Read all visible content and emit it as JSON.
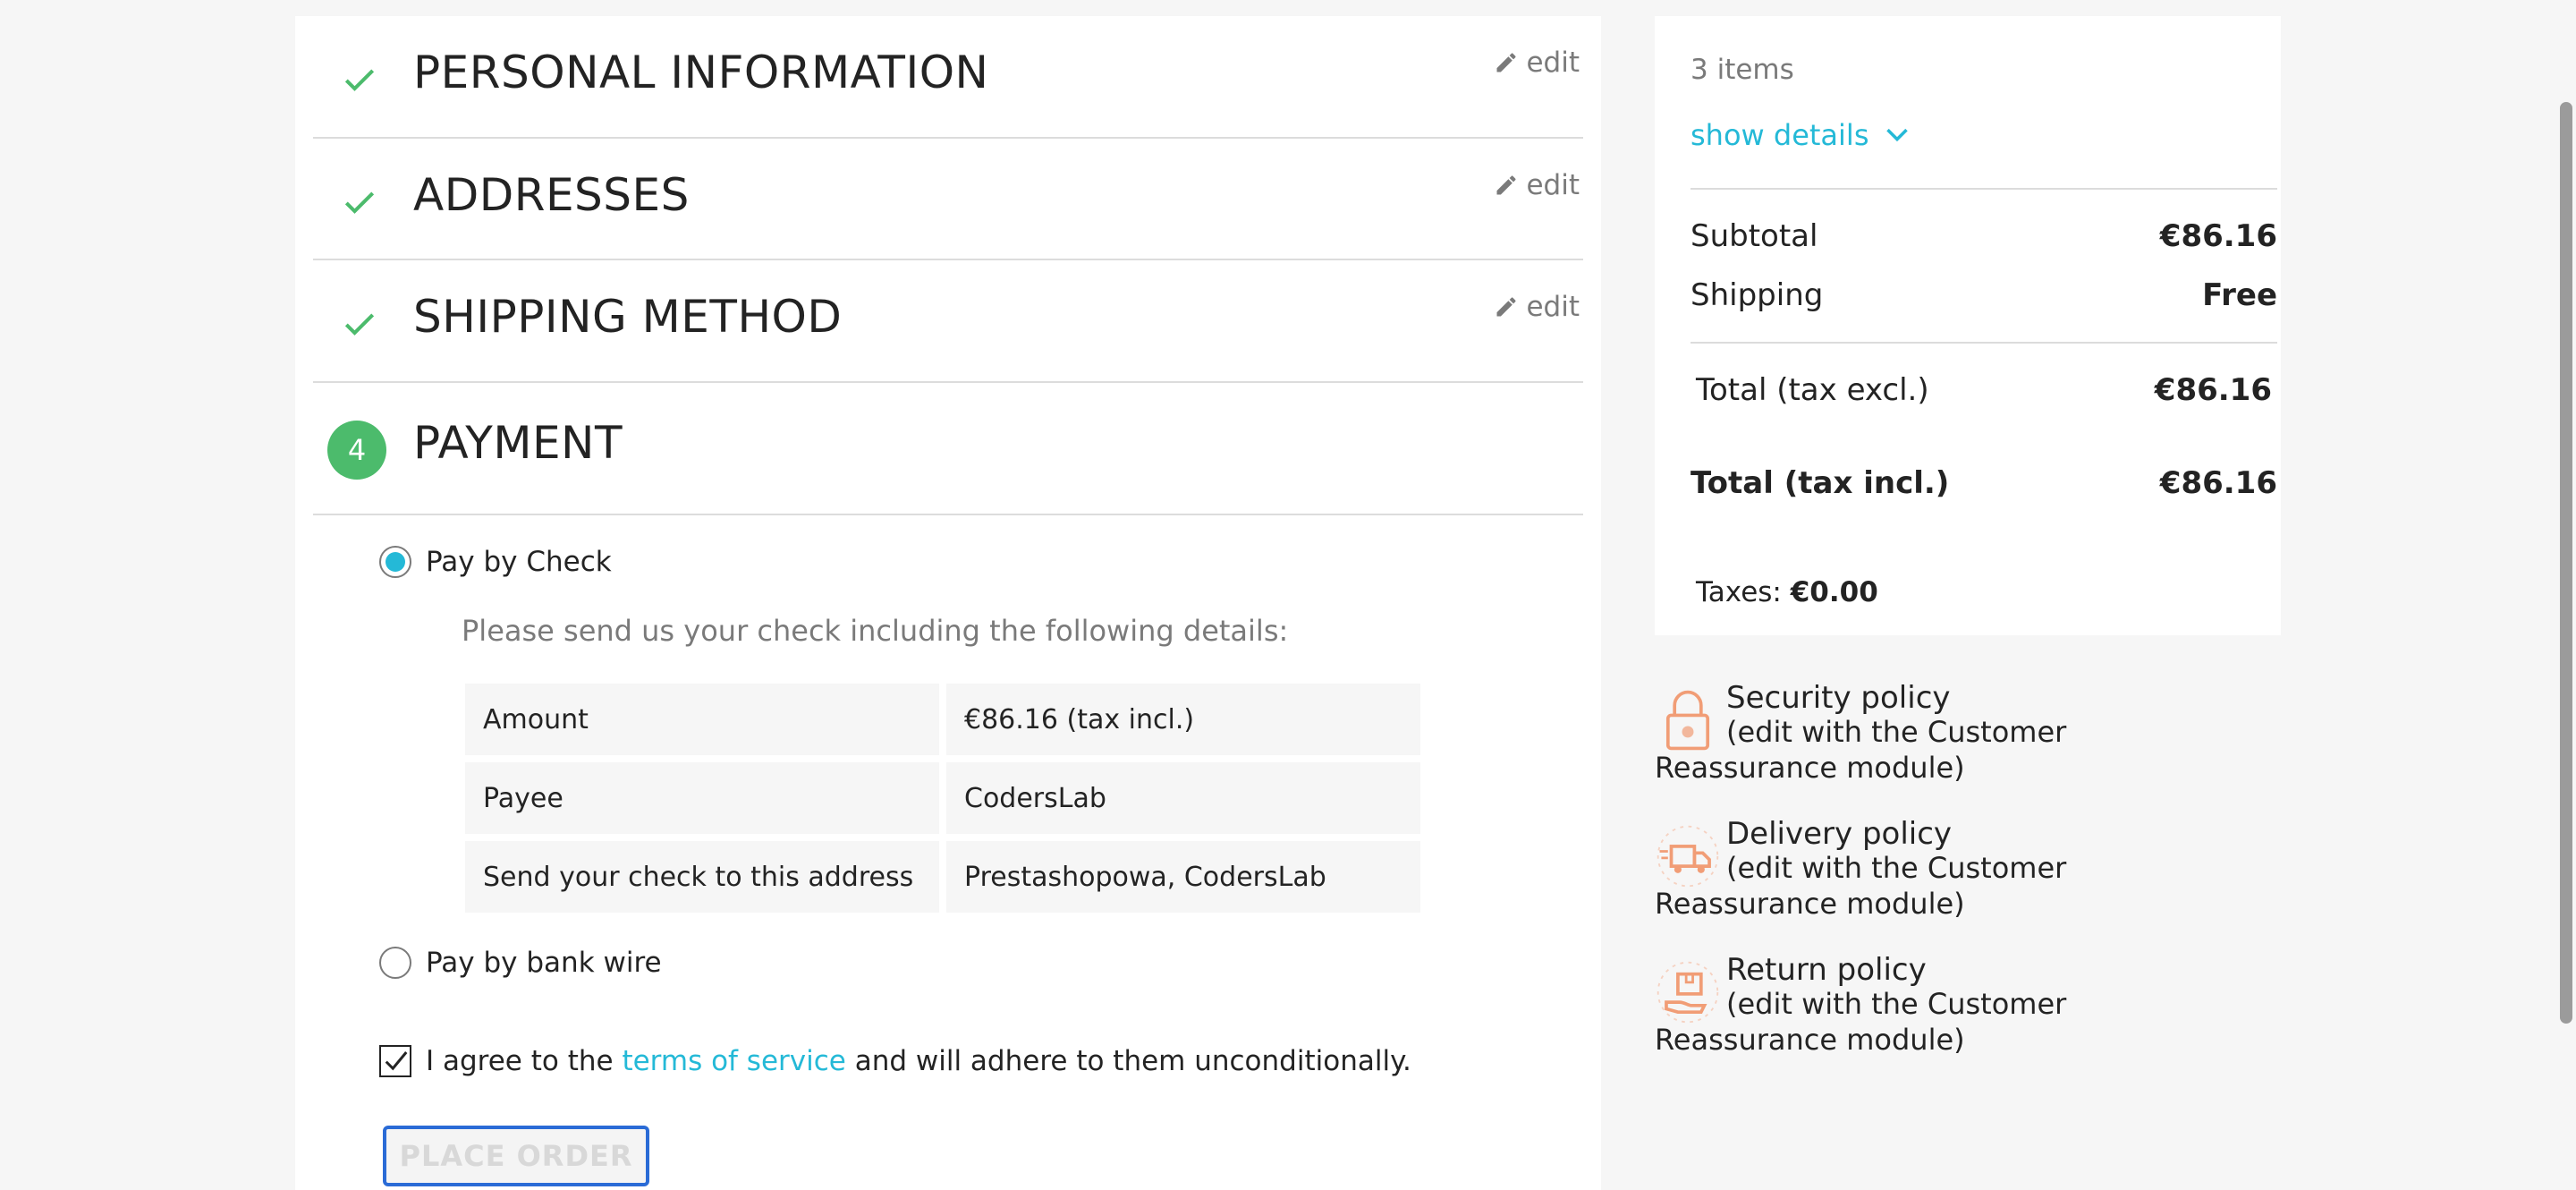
{
  "steps": [
    {
      "title": "PERSONAL INFORMATION",
      "edit": "edit"
    },
    {
      "title": "ADDRESSES",
      "edit": "edit"
    },
    {
      "title": "SHIPPING METHOD",
      "edit": "edit"
    }
  ],
  "payment": {
    "step_number": "4",
    "title": "PAYMENT",
    "option_check_label": "Pay by Check",
    "intro": "Please send us your check including the following details:",
    "rows": [
      {
        "key": "Amount",
        "value": "€86.16 (tax incl.)"
      },
      {
        "key": "Payee",
        "value": "CodersLab"
      },
      {
        "key": "Send your check to this address",
        "value": "Prestashopowa, CodersLab"
      }
    ],
    "option_wire_label": "Pay by bank wire",
    "agree_before": "I agree to the ",
    "agree_link": "terms of service",
    "agree_after": " and will adhere to them unconditionally.",
    "place_order": "PLACE ORDER"
  },
  "summary": {
    "items_count": "3 items",
    "show_details": "show details",
    "subtotal_label": "Subtotal",
    "subtotal_value": "€86.16",
    "shipping_label": "Shipping",
    "shipping_value": "Free",
    "total_excl_label": "Total (tax excl.)",
    "total_excl_value": "€86.16",
    "total_incl_label": "Total (tax incl.)",
    "total_incl_value": "€86.16",
    "taxes_label": "Taxes: ",
    "taxes_value": "€0.00"
  },
  "reassurance": [
    {
      "title": "Security policy",
      "desc": "(edit with the Customer Reassurance module)",
      "icon": "lock-icon"
    },
    {
      "title": "Delivery policy",
      "desc": "(edit with the Customer Reassurance module)",
      "icon": "delivery-truck-icon"
    },
    {
      "title": "Return policy",
      "desc": "(edit with the Customer Reassurance module)",
      "icon": "return-box-icon"
    }
  ],
  "colors": {
    "accent": "#24b9d7",
    "success": "#4cbb6c",
    "reassurance_icon": "#f19d76",
    "focus_border": "#2a6bd6"
  }
}
